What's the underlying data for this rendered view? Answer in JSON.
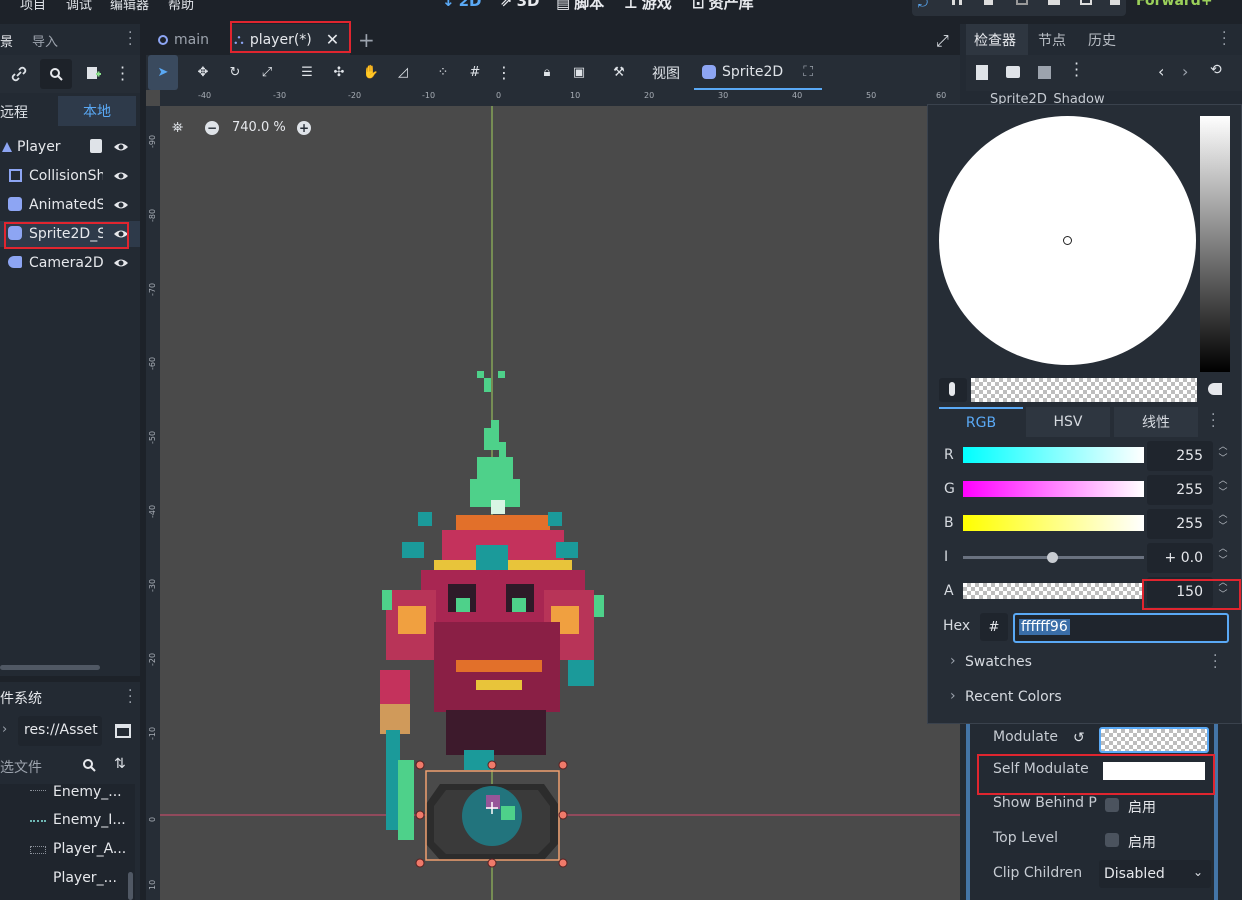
{
  "menu": [
    "项目",
    "调试",
    "编辑器",
    "帮助"
  ],
  "modes": [
    "2D",
    "3D",
    "脚本",
    "游戏",
    "资产库"
  ],
  "renderer": "Forward+",
  "left_dock": {
    "tabs": [
      "景",
      "导入"
    ],
    "remote_tabs": [
      "远程",
      "本地"
    ],
    "scene_tree": [
      {
        "label": "Player",
        "icon": "node2d-icon",
        "indent": 0
      },
      {
        "label": "CollisionSh",
        "icon": "collision-shape-icon",
        "indent": 1
      },
      {
        "label": "AnimatedS",
        "icon": "animated-sprite-icon",
        "indent": 1
      },
      {
        "label": "Sprite2D_S",
        "icon": "sprite2d-icon",
        "indent": 1
      },
      {
        "label": "Camera2D",
        "icon": "camera2d-icon",
        "indent": 1
      }
    ],
    "filesystem": {
      "title": "件系统",
      "path": "res://Asset",
      "filter_placeholder": "选文件",
      "files": [
        "Enemy_...",
        "Enemy_I...",
        "Player_A...",
        "Player_..."
      ]
    }
  },
  "scene_tabs": [
    {
      "label": "main",
      "icon": "circle-icon"
    },
    {
      "label": "player(*)",
      "icon": "scene-icon"
    }
  ],
  "toolbar": {
    "view_label": "视图",
    "sprite_label": "Sprite2D"
  },
  "viewport": {
    "zoom": "740.0 %",
    "ruler_x": [
      "-40",
      "-30",
      "-20",
      "-10",
      "0",
      "10",
      "20",
      "30",
      "40",
      "50",
      "60"
    ],
    "ruler_y": [
      "-90",
      "-80",
      "-70",
      "-60",
      "-50",
      "-40",
      "-30",
      "-20",
      "-10",
      "0",
      "10"
    ]
  },
  "inspector": {
    "tabs": [
      "检查器",
      "节点",
      "历史"
    ],
    "node_partial": "Sprite2D_Shadow"
  },
  "color_picker": {
    "modes": [
      "RGB",
      "HSV",
      "线性"
    ],
    "channels": [
      {
        "name": "R",
        "value": "255"
      },
      {
        "name": "G",
        "value": "255"
      },
      {
        "name": "B",
        "value": "255"
      },
      {
        "name": "I",
        "value": "+ 0.0"
      },
      {
        "name": "A",
        "value": "150"
      }
    ],
    "hex_label": "Hex",
    "hex_hash": "#",
    "hex_value": "ffffff96",
    "swatches_label": "Swatches",
    "recent_label": "Recent Colors"
  },
  "properties": [
    {
      "name": "Modulate"
    },
    {
      "name": "Self Modulate"
    },
    {
      "name": "Show Behind P",
      "value": "启用"
    },
    {
      "name": "Top Level",
      "value": "启用"
    },
    {
      "name": "Clip Children",
      "value": "Disabled"
    }
  ],
  "colors": {
    "accent": "#5aa9f5",
    "highlight": "#e0252f",
    "panel": "#232a33",
    "viewport": "#4a4a4a"
  }
}
